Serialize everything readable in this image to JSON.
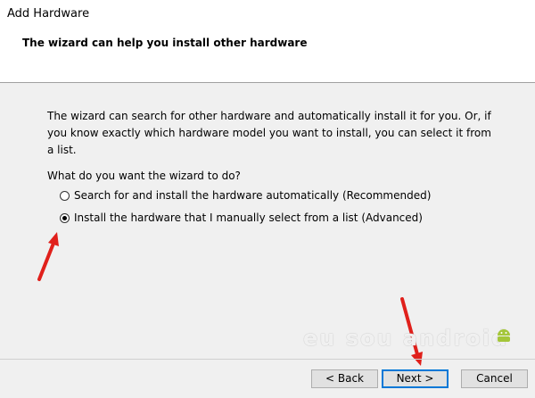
{
  "window": {
    "title": "Add Hardware"
  },
  "header": {
    "title": "The wizard can help you install other hardware"
  },
  "main": {
    "description": "The wizard can search for other hardware and automatically install it for you. Or, if you know exactly which hardware model you want to install, you can select it from a list.",
    "question": "What do you want the wizard to do?",
    "options": [
      {
        "label": "Search for and install the hardware automatically (Recommended)",
        "selected": false
      },
      {
        "label": "Install the hardware that I manually select from a list (Advanced)",
        "selected": true
      }
    ]
  },
  "watermark": {
    "text": "eu sou android"
  },
  "buttons": {
    "back": "< Back",
    "next": "Next >",
    "cancel": "Cancel"
  },
  "colors": {
    "arrow": "#e0201b",
    "accent": "#0078d7"
  }
}
